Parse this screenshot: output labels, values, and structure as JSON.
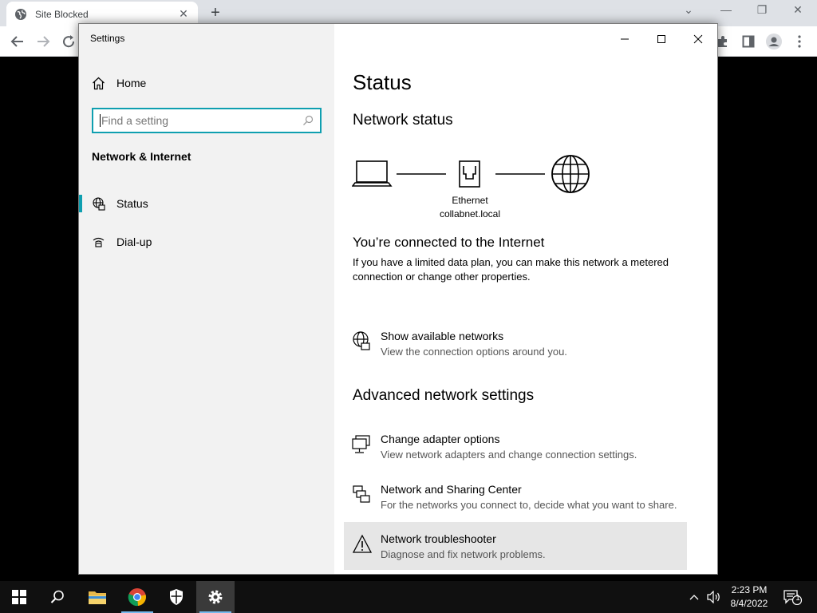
{
  "browser": {
    "tab_title": "Site Blocked",
    "tab_close": "✕",
    "new_tab": "+"
  },
  "window": {
    "title": "Settings"
  },
  "nav": {
    "home_label": "Home",
    "search_placeholder": "Find a setting",
    "section_heading": "Network & Internet",
    "items": [
      {
        "label": "Status",
        "selected": true
      },
      {
        "label": "Dial-up",
        "selected": false
      }
    ]
  },
  "content": {
    "title": "Status",
    "network_status_heading": "Network status",
    "diagram": {
      "adapter_name": "Ethernet",
      "domain": "collabnet.local"
    },
    "connected_title": "You’re connected to the Internet",
    "connected_desc": "If you have a limited data plan, you can make this network a metered connection or change other properties.",
    "show_networks": {
      "title": "Show available networks",
      "desc": "View the connection options around you."
    },
    "advanced_heading": "Advanced network settings",
    "advanced_items": [
      {
        "title": "Change adapter options",
        "desc": "View network adapters and change connection settings."
      },
      {
        "title": "Network and Sharing Center",
        "desc": "For the networks you connect to, decide what you want to share."
      },
      {
        "title": "Network troubleshooter",
        "desc": "Diagnose and fix network problems."
      }
    ]
  },
  "taskbar": {
    "time": "2:23 PM",
    "date": "8/4/2022",
    "notification_count": "1"
  },
  "colors": {
    "accent": "#0f9fb0",
    "taskbar": "#101010"
  }
}
